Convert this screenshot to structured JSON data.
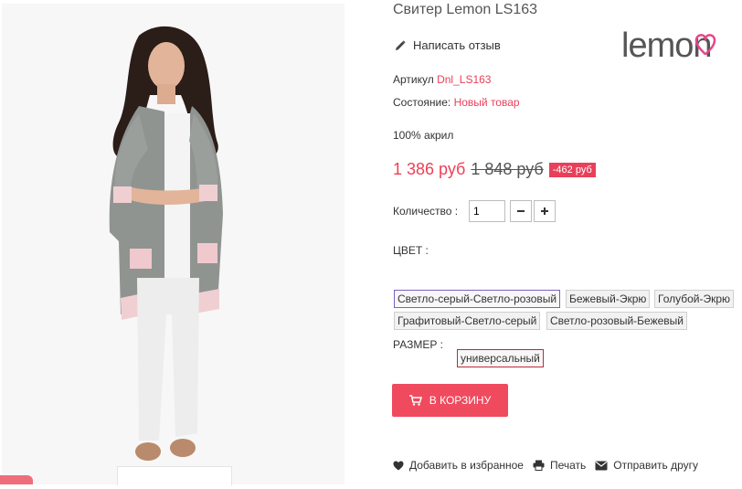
{
  "product": {
    "title": "Свитер Lemon LS163",
    "review_link": "Написать отзыв",
    "sku_label": "Артикул",
    "sku": "Dnl_LS163",
    "condition_label": "Состояние:",
    "condition": "Новый товар",
    "composition": "100% акрил"
  },
  "brand": {
    "logo_text": "lemon",
    "colors": {
      "text": "#555555",
      "heart": "#e8458c"
    }
  },
  "price": {
    "current": "1 386 руб",
    "old": "1 848 руб",
    "discount": "-462 руб"
  },
  "quantity": {
    "label": "Количество :",
    "value": "1",
    "minus": "−",
    "plus": "+"
  },
  "color": {
    "label": "ЦВЕТ :",
    "options": [
      "Светло-серый-Светло-розовый",
      "Бежевый-Экрю",
      "Голубой-Экрю",
      "Графитовый-Светло-серый",
      "Светло-розовый-Бежевый"
    ],
    "selected": "Светло-серый-Светло-розовый"
  },
  "size": {
    "label": "РАЗМЕР :",
    "options": [
      "универсальный"
    ],
    "selected": "универсальный"
  },
  "cart": {
    "label": "В КОРЗИНУ"
  },
  "actions": {
    "wishlist": "Добавить в избранное",
    "print": "Печать",
    "send": "Отправить другу"
  },
  "theme": {
    "accent": "#ef4a5e",
    "price": "#ef4056",
    "link": "#e8405a"
  }
}
